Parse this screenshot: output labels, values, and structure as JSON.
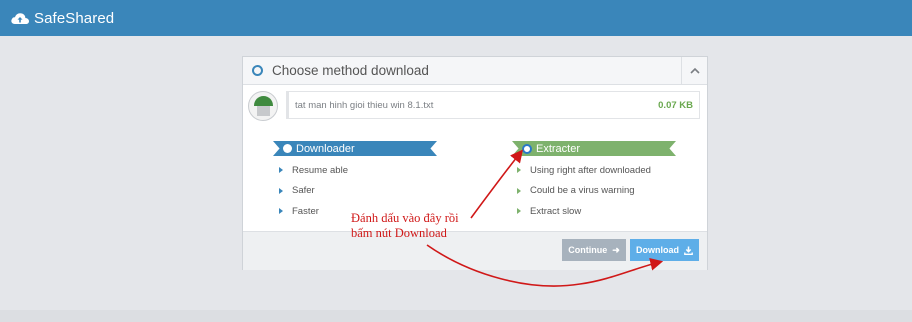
{
  "app": {
    "brand": "SafeShared",
    "brand_icon": "cloud-upload-icon",
    "accent": "#3a86ba"
  },
  "panel": {
    "title": "Choose method download",
    "collapse_icon": "chevron-up-icon",
    "file": {
      "name": "tat man hinh gioi thieu win 8.1.txt",
      "size": "0.07 KB"
    },
    "methods": [
      {
        "label": "Downloader",
        "color": "#3a86ba",
        "selected": false,
        "features": [
          "Resume able",
          "Safer",
          "Faster"
        ]
      },
      {
        "label": "Extracter",
        "color": "#7eb26d",
        "selected": true,
        "features": [
          "Using right after downloaded",
          "Could be a virus warning",
          "Extract slow"
        ]
      }
    ],
    "buttons": {
      "continue_label": "Continue",
      "continue_icon": "arrow-right-icon",
      "download_label": "Download",
      "download_icon": "download-icon"
    }
  },
  "annotation": {
    "line1": "Đánh dấu vào đây rồi",
    "line2": "bấm nút Download",
    "color": "#d01818"
  }
}
